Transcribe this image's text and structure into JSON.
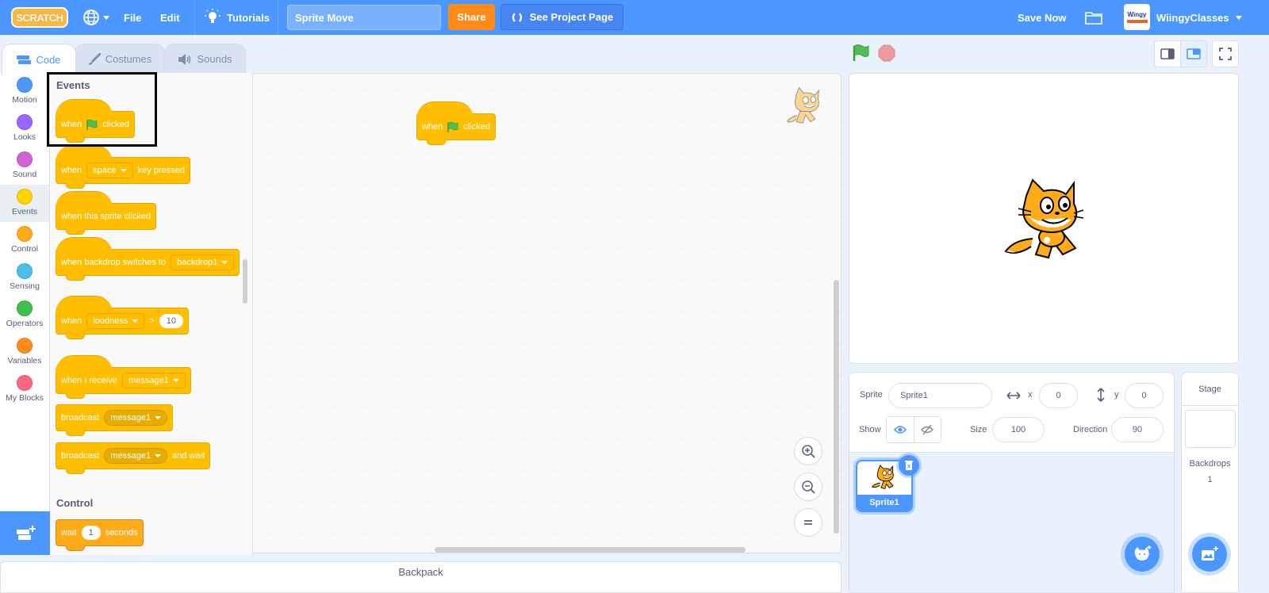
{
  "menubar": {
    "logo": "SCRATCH",
    "language_icon": "globe-icon",
    "file": "File",
    "edit": "Edit",
    "tutorials": "Tutorials",
    "project_title": "Sprite Move",
    "share": "Share",
    "see_project_page": "See Project Page",
    "save_now": "Save Now",
    "my_stuff_icon": "folder-icon",
    "avatar_text": "Wingy",
    "username": "WiingyClasses"
  },
  "tabs": [
    {
      "label": "Code",
      "icon": "code-icon",
      "active": true
    },
    {
      "label": "Costumes",
      "icon": "brush-icon",
      "active": false
    },
    {
      "label": "Sounds",
      "icon": "speaker-icon",
      "active": false
    }
  ],
  "categories": [
    {
      "label": "Motion",
      "color": "#4c97ff"
    },
    {
      "label": "Looks",
      "color": "#9966ff"
    },
    {
      "label": "Sound",
      "color": "#cf63cf"
    },
    {
      "label": "Events",
      "color": "#ffd500",
      "selected": true
    },
    {
      "label": "Control",
      "color": "#ffab19"
    },
    {
      "label": "Sensing",
      "color": "#4cbfe6"
    },
    {
      "label": "Operators",
      "color": "#40bf4a"
    },
    {
      "label": "Variables",
      "color": "#ff8c1a"
    },
    {
      "label": "My Blocks",
      "color": "#ff6680"
    }
  ],
  "palette": {
    "events_heading": "Events",
    "control_heading": "Control",
    "blocks": {
      "flag_clicked": {
        "pre": "when",
        "post": "clicked"
      },
      "key_pressed": {
        "pre": "when",
        "dropdown": "space",
        "post": "key pressed"
      },
      "sprite_clicked": {
        "text": "when this sprite clicked"
      },
      "backdrop_switches": {
        "pre": "when backdrop switches to",
        "dropdown": "backdrop1"
      },
      "loudness": {
        "pre": "when",
        "dropdown": "loudness",
        "op": ">",
        "value": "10"
      },
      "receive": {
        "pre": "when I receive",
        "dropdown": "message1"
      },
      "broadcast": {
        "pre": "broadcast",
        "dropdown": "message1"
      },
      "broadcast_wait": {
        "pre": "broadcast",
        "dropdown": "message1",
        "post": "and wait"
      },
      "wait": {
        "pre": "wait",
        "value": "1",
        "post": "seconds"
      }
    }
  },
  "workspace": {
    "script": {
      "pre": "when",
      "post": "clicked"
    }
  },
  "backpack": "Backpack",
  "sprite_info": {
    "sprite_label": "Sprite",
    "sprite_name": "Sprite1",
    "x_label": "x",
    "x": "0",
    "y_label": "y",
    "y": "0",
    "show_label": "Show",
    "size_label": "Size",
    "size": "100",
    "direction_label": "Direction",
    "direction": "90"
  },
  "sprites": [
    {
      "name": "Sprite1",
      "selected": true
    }
  ],
  "stage_panel": {
    "title": "Stage",
    "backdrops_label": "Backdrops",
    "backdrops_count": "1"
  },
  "colors": {
    "brand": "#4c97ff",
    "share": "#ff8c1a",
    "events_block": "#ffbf00",
    "control_block": "#ffab19"
  }
}
